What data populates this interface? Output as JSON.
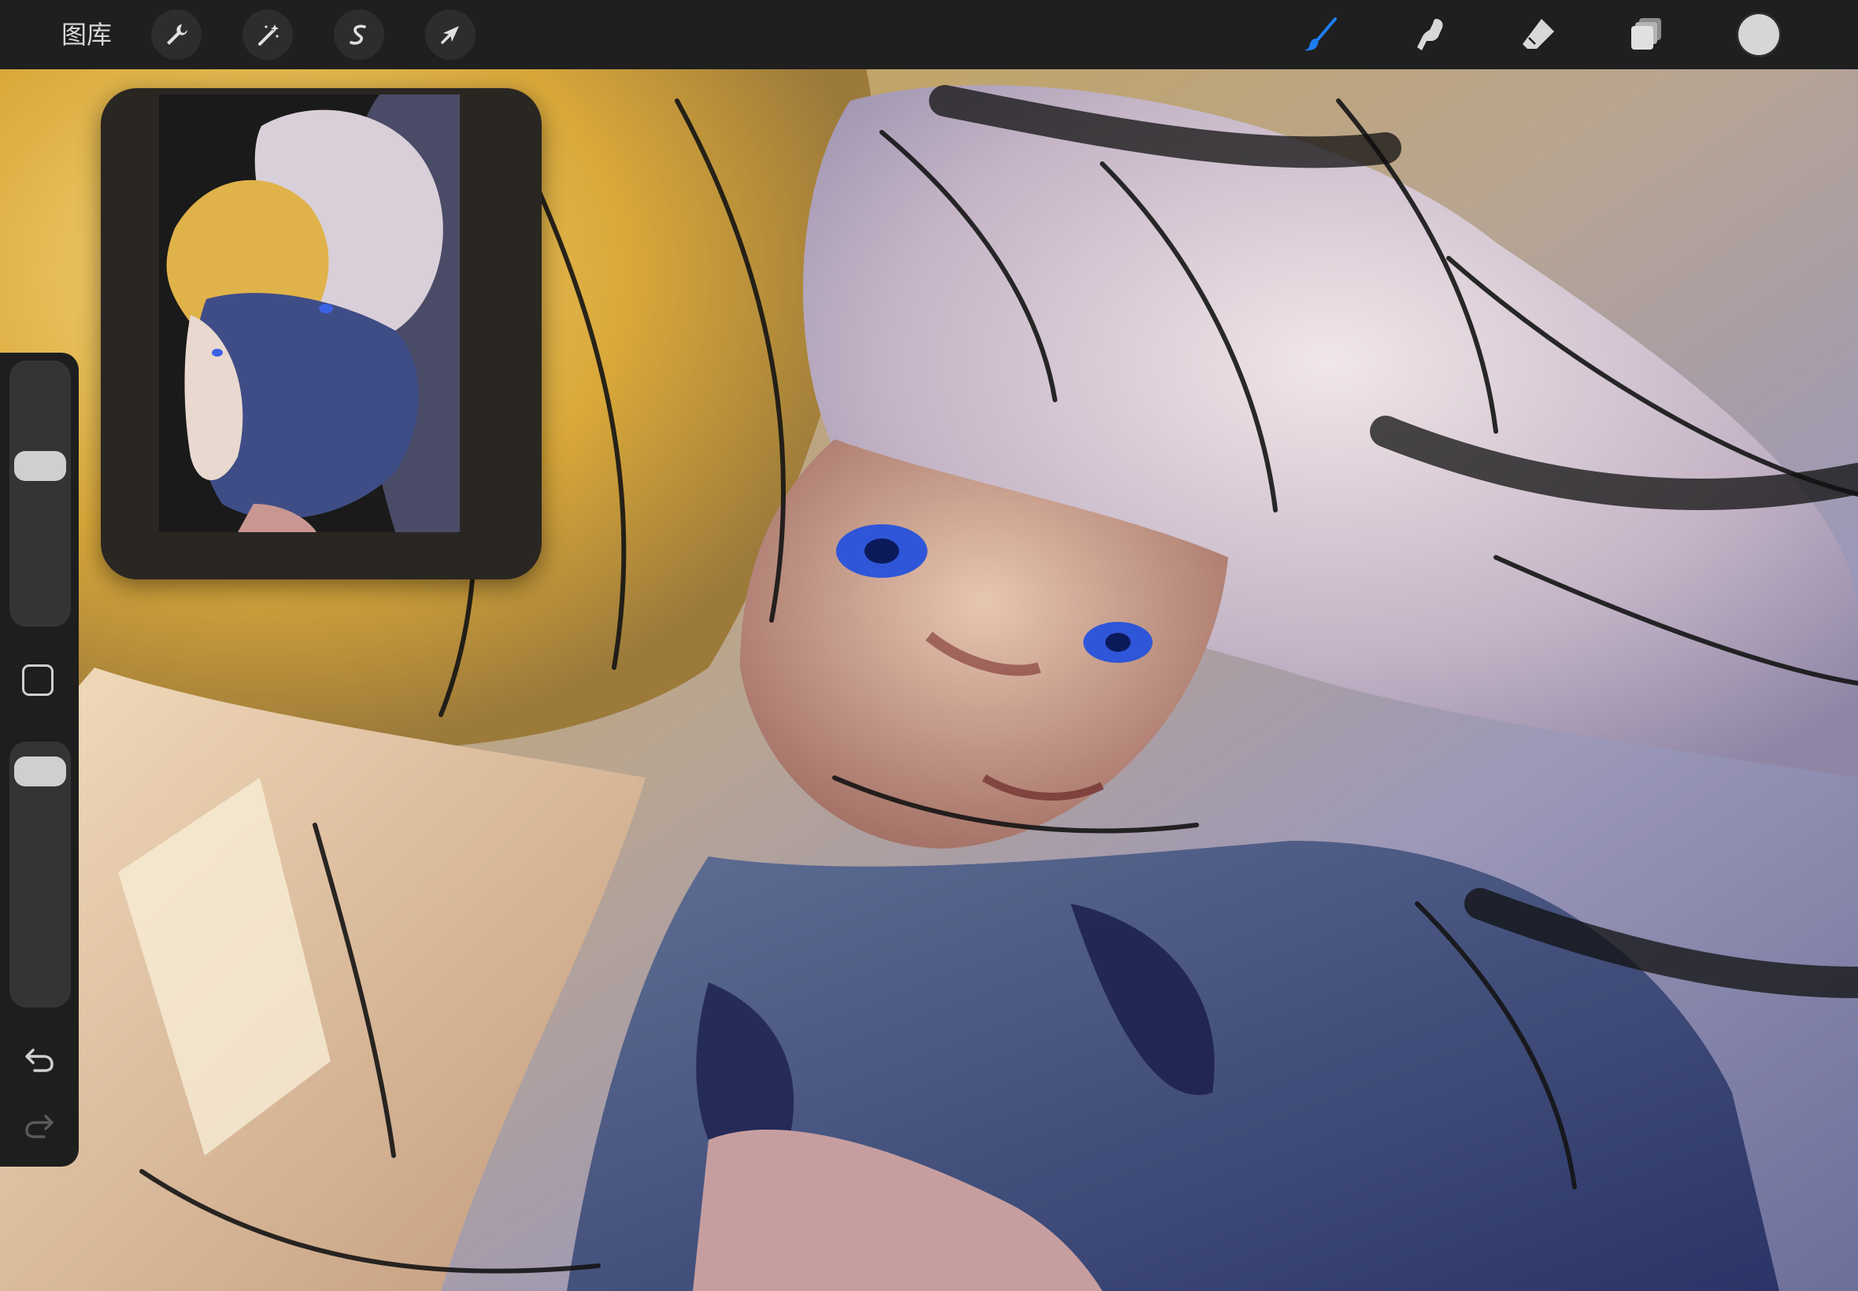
{
  "toolbar": {
    "gallery_label": "图库",
    "left_tools": [
      {
        "name": "actions",
        "icon": "wrench-icon"
      },
      {
        "name": "adjustments",
        "icon": "magic-wand-icon"
      },
      {
        "name": "selection",
        "icon": "selection-s-icon"
      },
      {
        "name": "transform",
        "icon": "arrow-cursor-icon"
      }
    ],
    "right_tools": [
      {
        "name": "brush",
        "icon": "brush-icon",
        "active": true
      },
      {
        "name": "smudge",
        "icon": "smudge-finger-icon",
        "active": false
      },
      {
        "name": "eraser",
        "icon": "eraser-icon",
        "active": false
      },
      {
        "name": "layers",
        "icon": "layers-icon",
        "active": false
      }
    ],
    "active_color": "#d6d6d6",
    "accent_color": "#1e7cf2"
  },
  "sidebar": {
    "brush_size_level": 0.62,
    "opacity_level": 0.95,
    "icons": [
      "modify-square-icon",
      "undo-icon",
      "redo-icon"
    ]
  },
  "reference_window": {
    "visible": true
  }
}
